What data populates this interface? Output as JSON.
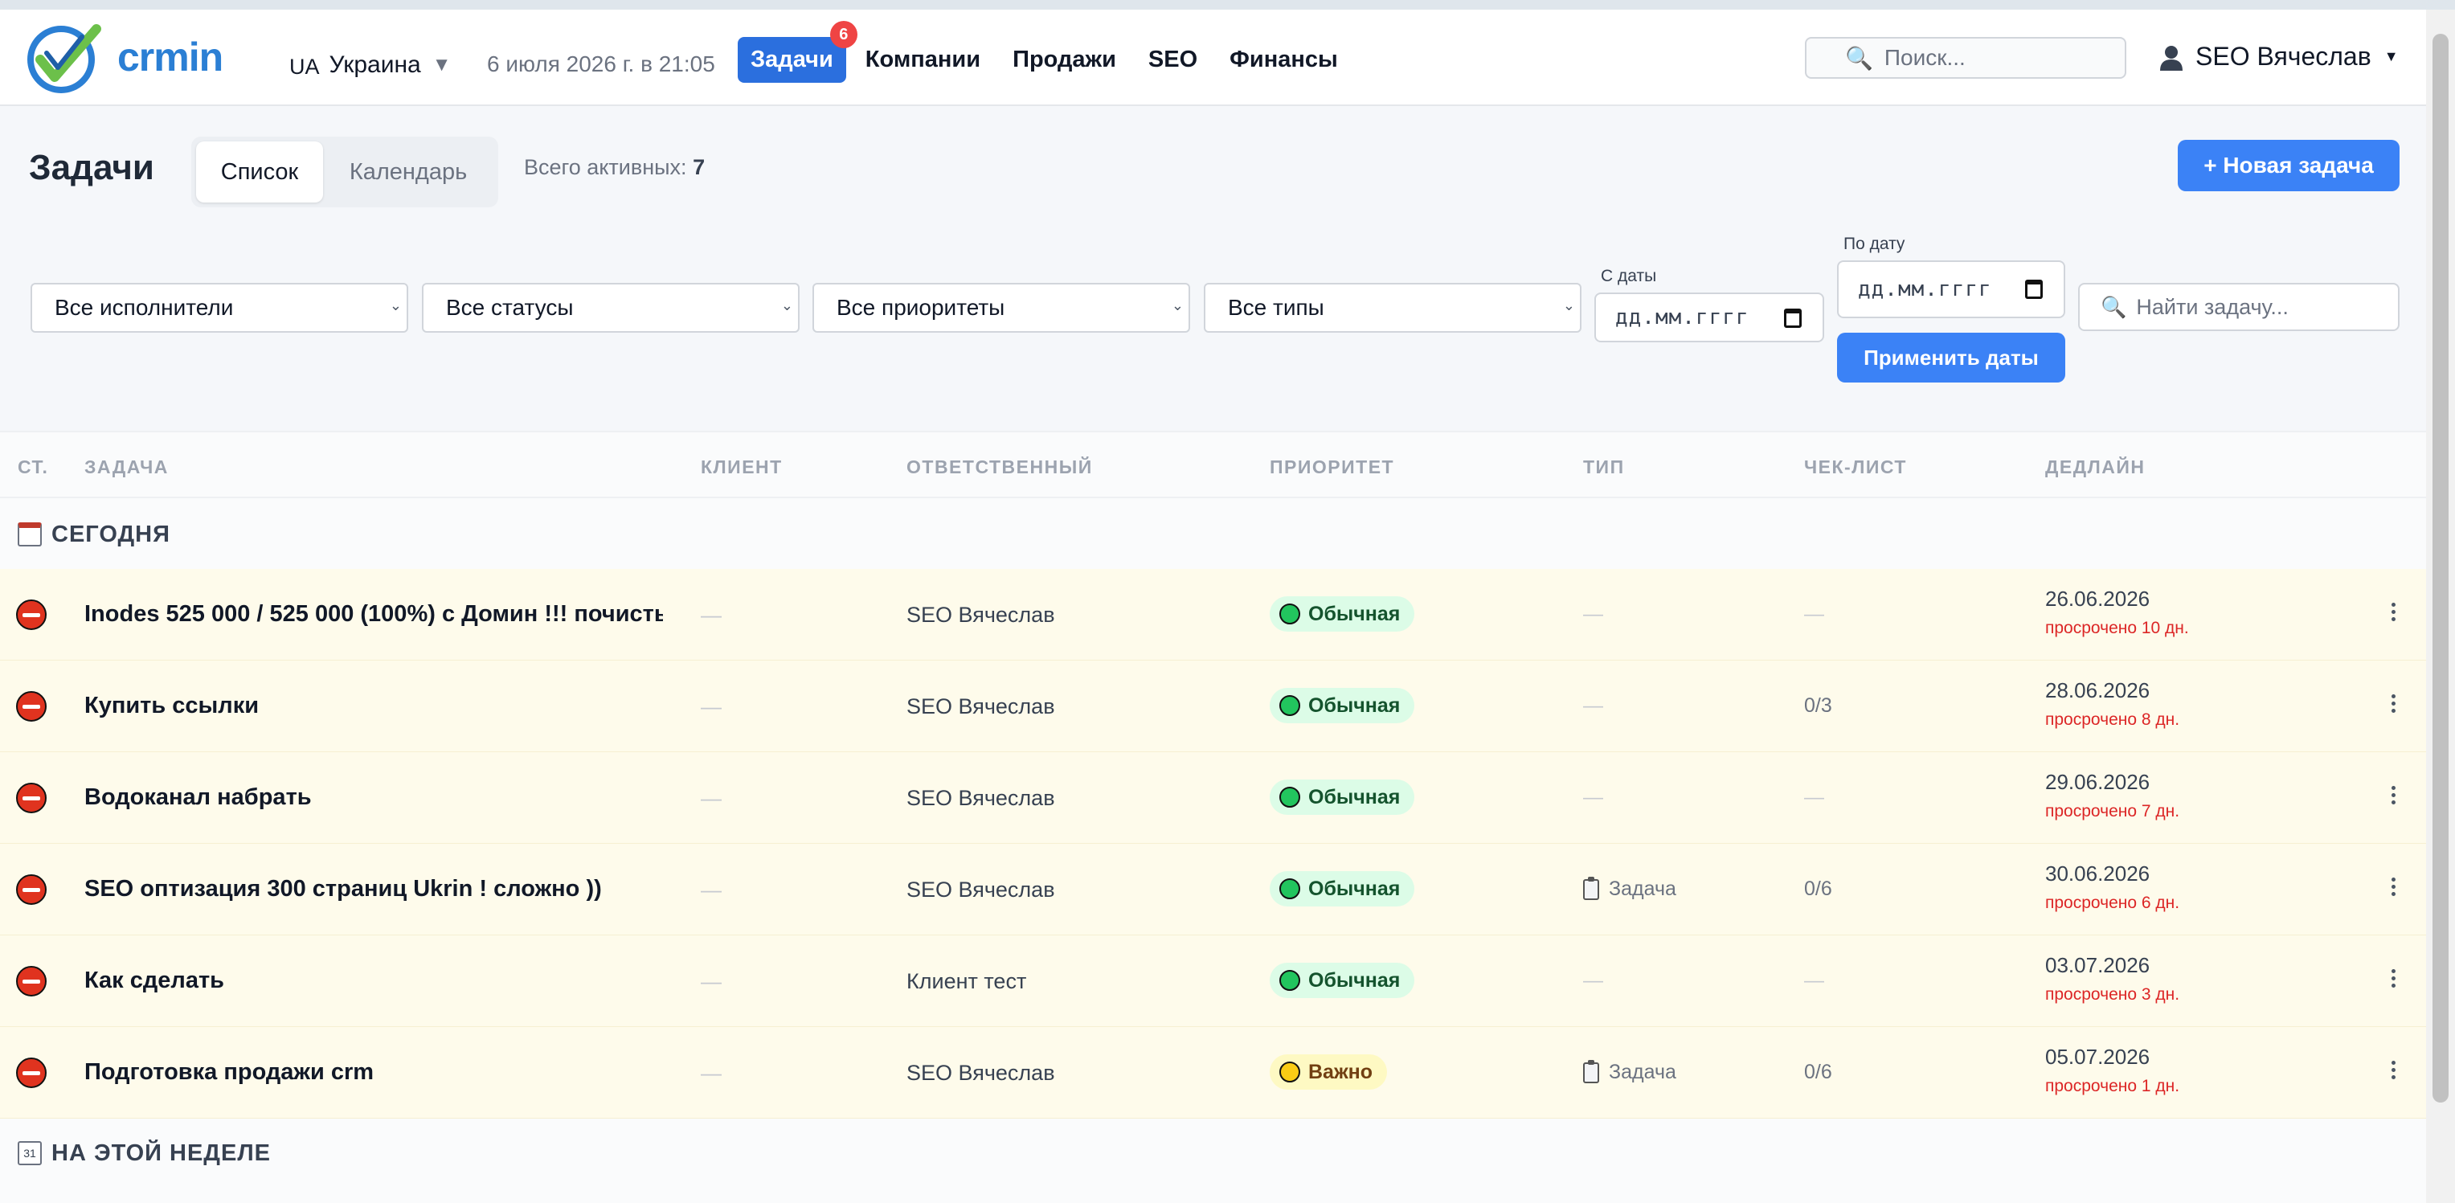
{
  "header": {
    "logo_text": "crmin",
    "region_code": "UA",
    "region_name": "Украина",
    "datetime": "6 июля 2026 г. в 21:05",
    "nav": [
      {
        "label": "Задачи",
        "badge": "6",
        "active": true
      },
      {
        "label": "Компании"
      },
      {
        "label": "Продажи"
      },
      {
        "label": "SEO"
      },
      {
        "label": "Финансы"
      }
    ],
    "search_placeholder": "Поиск...",
    "user_name": "SEO Вячеслав"
  },
  "toolbar": {
    "title": "Задачи",
    "views": [
      "Список",
      "Календарь"
    ],
    "active_view": "Список",
    "total_label": "Всего активных:",
    "total_count": "7",
    "new_task_label": "+ Новая задача"
  },
  "filters": {
    "assignee": "Все исполнители",
    "status": "Все статусы",
    "priority": "Все приоритеты",
    "type": "Все типы",
    "date_from_label": "С даты",
    "date_from_placeholder": "дд.мм.гггг",
    "date_to_label": "По дату",
    "date_to_placeholder": "дд.мм.гггг",
    "apply_label": "Применить даты",
    "search_placeholder": "Найти задачу..."
  },
  "table": {
    "columns": [
      "СТ.",
      "ЗАДАЧА",
      "КЛИЕНТ",
      "ОТВЕТСТВЕННЫЙ",
      "ПРИОРИТЕТ",
      "ТИП",
      "ЧЕК-ЛИСТ",
      "ДЕДЛАЙН"
    ],
    "groups": [
      {
        "title": "СЕГОДНЯ",
        "rows": [
          {
            "title": "Inodes 525 000 / 525 000 (100%) с Домин !!! почисть ...",
            "client": "—",
            "owner": "SEO Вячеслав",
            "priority": "Обычная",
            "type": "—",
            "checklist": "—",
            "deadline": "26.06.2026",
            "overdue": "просрочено 10 дн."
          },
          {
            "title": "Купить ссылки",
            "client": "—",
            "owner": "SEO Вячеслав",
            "priority": "Обычная",
            "type": "—",
            "checklist": "0/3",
            "deadline": "28.06.2026",
            "overdue": "просрочено 8 дн."
          },
          {
            "title": "Водоканал набрать",
            "client": "—",
            "owner": "SEO Вячеслав",
            "priority": "Обычная",
            "type": "—",
            "checklist": "—",
            "deadline": "29.06.2026",
            "overdue": "просрочено 7 дн."
          },
          {
            "title": "SEO оптизация 300 страниц Ukrin ! сложно ))",
            "client": "—",
            "owner": "SEO Вячеслав",
            "priority": "Обычная",
            "type": "Задача",
            "checklist": "0/6",
            "deadline": "30.06.2026",
            "overdue": "просрочено 6 дн."
          },
          {
            "title": "Как сделать",
            "client": "—",
            "owner": "Клиент тест",
            "priority": "Обычная",
            "type": "—",
            "checklist": "—",
            "deadline": "03.07.2026",
            "overdue": "просрочено 3 дн."
          },
          {
            "title": "Подготовка продажи crm",
            "client": "—",
            "owner": "SEO Вячеслав",
            "priority": "Важно",
            "type": "Задача",
            "checklist": "0/6",
            "deadline": "05.07.2026",
            "overdue": "просрочено 1 дн."
          }
        ]
      },
      {
        "title": "НА ЭТОЙ НЕДЕЛЕ",
        "icon_day": "31",
        "rows": []
      }
    ]
  },
  "colors": {
    "accent": "#3b82f6",
    "nav_active": "#2b6fde",
    "overdue": "#dc2626",
    "row_highlight": "#fefbeb",
    "priority_normal": "#22c55e",
    "priority_important": "#facc15"
  }
}
